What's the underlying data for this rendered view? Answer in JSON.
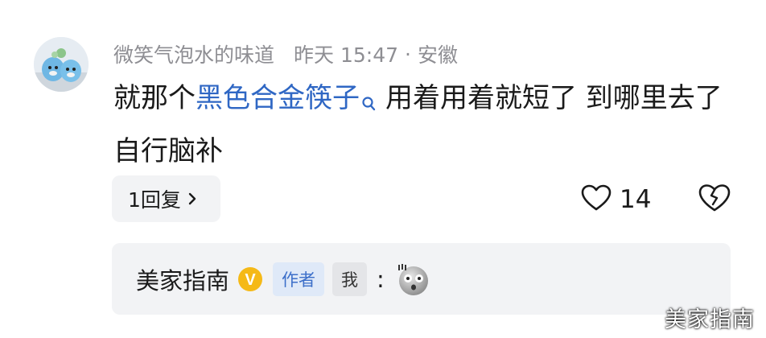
{
  "comment": {
    "username": "微笑气泡水的味道",
    "time": "昨天 15:47",
    "separator": "·",
    "location": "安徽",
    "text_before": "就那个",
    "linked_keyword": "黑色合金筷子",
    "text_after": "用着用着就短了 到哪里去了自行脑补",
    "reply_button": "1回复",
    "like_count": "14",
    "icons": {
      "search": "search-icon",
      "like": "heart-icon",
      "dislike": "broken-heart-icon",
      "chevron": "chevron-right-icon"
    },
    "link_color": "#2f67c4"
  },
  "sub_reply": {
    "name": "美家指南",
    "badge": "V",
    "tag_author": "作者",
    "tag_me": "我",
    "colon": ":",
    "emoji_name": "shocked-face-emoji"
  },
  "watermark": "美家指南"
}
